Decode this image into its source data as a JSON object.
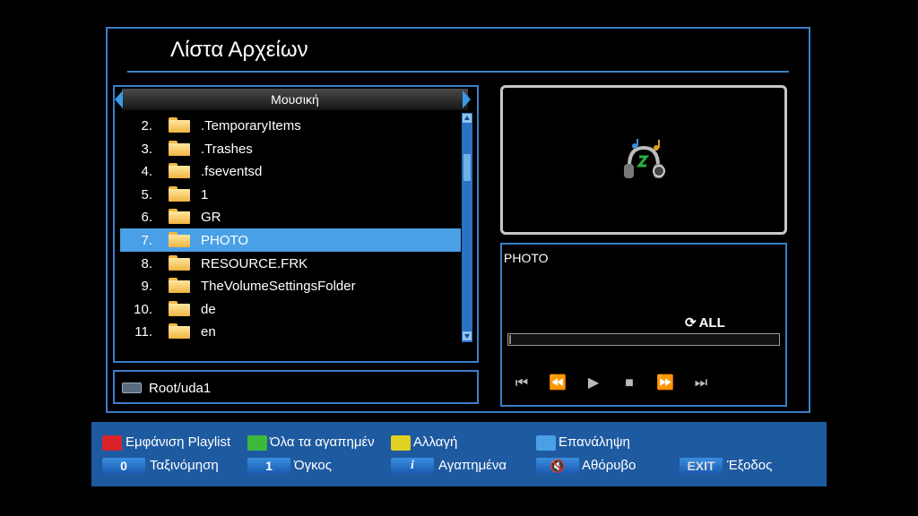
{
  "title": "Λίστα Αρχείων",
  "list": {
    "header": "Μουσική",
    "items": [
      {
        "num": "2.",
        "name": ".TemporaryItems"
      },
      {
        "num": "3.",
        "name": ".Trashes"
      },
      {
        "num": "4.",
        "name": ".fseventsd"
      },
      {
        "num": "5.",
        "name": "1"
      },
      {
        "num": "6.",
        "name": "GR"
      },
      {
        "num": "7.",
        "name": "PHOTO",
        "selected": true
      },
      {
        "num": "8.",
        "name": "RESOURCE.FRK"
      },
      {
        "num": "9.",
        "name": "TheVolumeSettingsFolder"
      },
      {
        "num": "10.",
        "name": "de"
      },
      {
        "num": "11.",
        "name": "en"
      }
    ]
  },
  "path": "Root/uda1",
  "info": {
    "title": "PHOTO",
    "repeat": "ALL",
    "progress": 0.0
  },
  "controls": [
    "skip-back-icon",
    "rewind-icon",
    "play-icon",
    "stop-icon",
    "fast-forward-icon",
    "skip-forward-icon"
  ],
  "footer": {
    "red": "Εμφάνιση Playlist",
    "green": "Όλα τα αγαπημέν",
    "yellow": "Αλλαγή",
    "blue": "Επανάληψη",
    "key0_label": "0",
    "key0_text": "Ταξινόμηση",
    "key1_label": "1",
    "key1_text": "Όγκος",
    "info_text": "Αγαπημένα",
    "mute_text": "Αθόρυβο",
    "exit_label": "EXIT",
    "exit_text": "Έξοδος"
  },
  "colors": {
    "accent": "#3a7fc8",
    "selected": "#4aa0e6",
    "footer": "#1e5aa0",
    "red": "#d9222a",
    "green": "#3cb83c",
    "yellow": "#e0d020",
    "blue": "#4aa0e6"
  }
}
